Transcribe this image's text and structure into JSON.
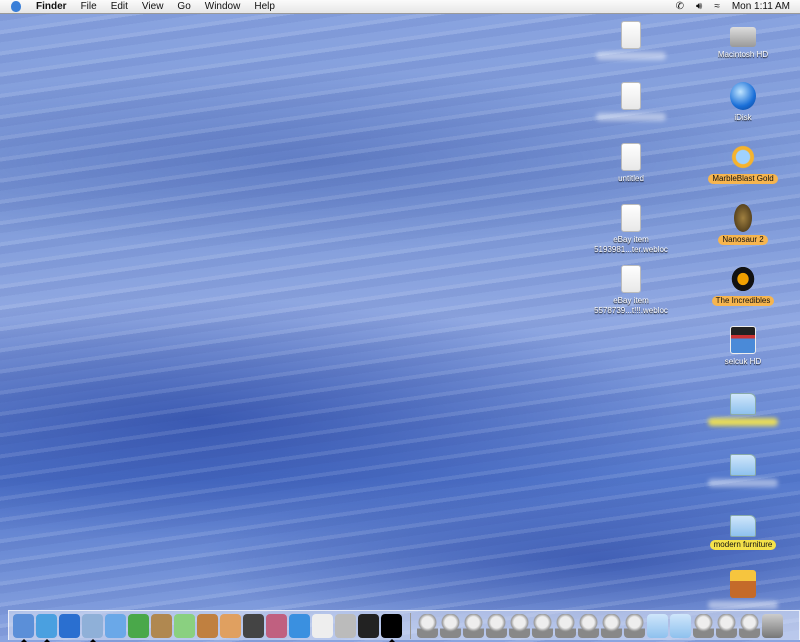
{
  "menubar": {
    "app": "Finder",
    "items": [
      "File",
      "Edit",
      "View",
      "Go",
      "Window",
      "Help"
    ],
    "clock": "Mon 1:11 AM"
  },
  "desktop_left": [
    {
      "label": "",
      "blurred": true,
      "kind": "doc"
    },
    {
      "label": "",
      "blurred": true,
      "kind": "doc"
    },
    {
      "label": "untitled",
      "kind": "doc"
    },
    {
      "label": "eBay item 5193981...ter.webloc",
      "kind": "doc"
    },
    {
      "label": "eBay item 5578739...t!!!.webloc",
      "kind": "doc"
    }
  ],
  "desktop_right": [
    {
      "label": "Macintosh HD",
      "kind": "hd"
    },
    {
      "label": "iDisk",
      "kind": "globe"
    },
    {
      "label": "MarbleBlast Gold",
      "kind": "sun",
      "tag": "orange"
    },
    {
      "label": "Nanosaur 2",
      "kind": "egg",
      "tag": "orange"
    },
    {
      "label": "The Incredibles",
      "kind": "inc",
      "tag": "orange"
    },
    {
      "label": "selcuk HD",
      "kind": "clap"
    },
    {
      "label": "",
      "blurred": true,
      "tag": "yellow",
      "kind": "fold"
    },
    {
      "label": "",
      "blurred": true,
      "kind": "fold"
    },
    {
      "label": "modern furniture",
      "kind": "fold",
      "tag": "yellow"
    },
    {
      "label": "",
      "blurred": true,
      "kind": "pkg"
    }
  ],
  "dock": {
    "apps": [
      {
        "name": "finder",
        "color": "#5b8fd8",
        "running": true
      },
      {
        "name": "safari",
        "color": "#4aa0e0",
        "running": true
      },
      {
        "name": "internet-explorer",
        "color": "#2a6fd0"
      },
      {
        "name": "mail",
        "color": "#8fb0d8",
        "running": true
      },
      {
        "name": "ichat",
        "color": "#6aa8e8"
      },
      {
        "name": "msn-messenger",
        "color": "#4aa84a"
      },
      {
        "name": "address-book",
        "color": "#b08850"
      },
      {
        "name": "itunes",
        "color": "#8ad080"
      },
      {
        "name": "iphoto",
        "color": "#c08040"
      },
      {
        "name": "pages",
        "color": "#e0a060"
      },
      {
        "name": "imovie",
        "color": "#444"
      },
      {
        "name": "color-sync",
        "color": "#c06080"
      },
      {
        "name": "quicktime",
        "color": "#3a90e0"
      },
      {
        "name": "textedit",
        "color": "#eee"
      },
      {
        "name": "calculator",
        "color": "#bbb"
      },
      {
        "name": "terminal",
        "color": "#222"
      },
      {
        "name": "activity-monitor",
        "color": "#000",
        "running": true
      }
    ],
    "docs": [
      "webloc",
      "webloc",
      "webloc",
      "webloc",
      "webloc",
      "webloc",
      "webloc",
      "webloc",
      "webloc",
      "webloc",
      "folder",
      "folder",
      "webloc",
      "webloc",
      "webloc",
      "trash"
    ]
  }
}
